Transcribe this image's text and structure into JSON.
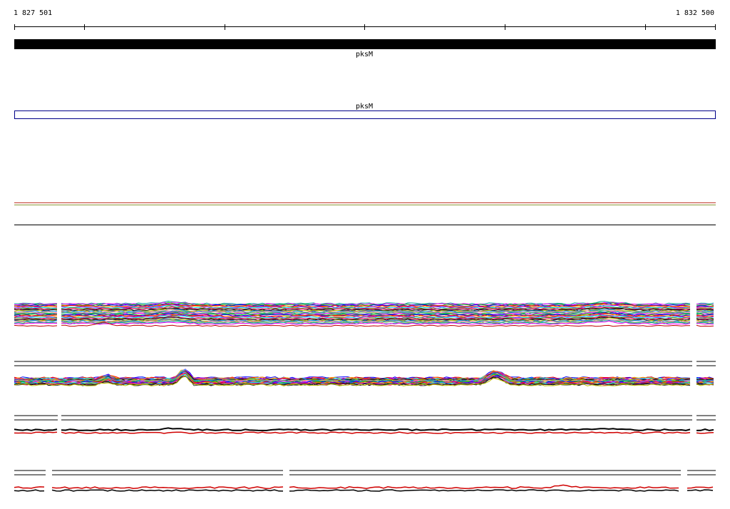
{
  "ruler": {
    "start_label": "1 827 501",
    "end_label": "1 832 500"
  },
  "genes": {
    "gene_name": "pksM",
    "cds_name": "pksM"
  },
  "colors": {
    "gene_bar": "#000000",
    "cds_outline": "#000088",
    "background": "#ffffff"
  },
  "tracks": [
    {
      "name": "multi-sample-coverage-track-1"
    },
    {
      "name": "multi-sample-coverage-track-2"
    },
    {
      "name": "red-black-coverage-track-3"
    },
    {
      "name": "red-black-coverage-track-4"
    }
  ]
}
